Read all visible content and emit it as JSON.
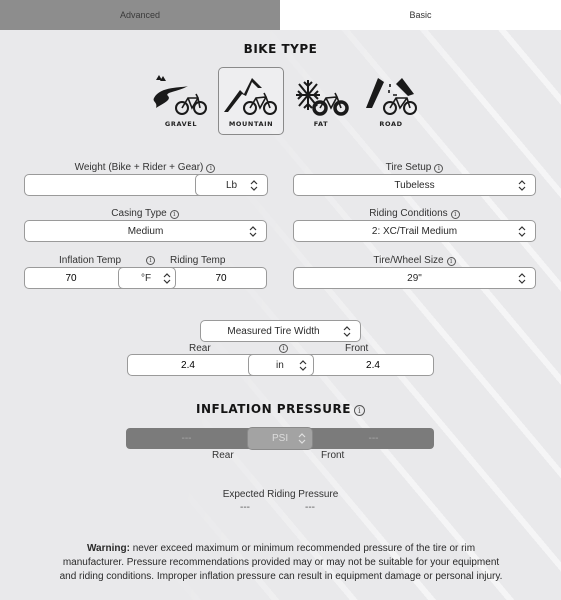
{
  "tabs": [
    {
      "label": "Advanced",
      "active": false
    },
    {
      "label": "Basic",
      "active": true
    }
  ],
  "bike_type": {
    "title": "BIKE TYPE",
    "options": [
      {
        "label": "GRAVEL",
        "icon": "gravel-bike-icon",
        "selected": false
      },
      {
        "label": "MOUNTAIN",
        "icon": "mountain-bike-icon",
        "selected": true
      },
      {
        "label": "FAT",
        "icon": "fat-bike-icon",
        "selected": false
      },
      {
        "label": "ROAD",
        "icon": "road-bike-icon",
        "selected": false
      }
    ]
  },
  "form": {
    "weight": {
      "label": "Weight (Bike + Rider + Gear)",
      "value": "",
      "unit": "Lb"
    },
    "tire_setup": {
      "label": "Tire Setup",
      "value": "Tubeless"
    },
    "casing_type": {
      "label": "Casing Type",
      "value": "Medium"
    },
    "riding_conditions": {
      "label": "Riding Conditions",
      "value": "2: XC/Trail Medium"
    },
    "inflation_temp": {
      "label": "Inflation Temp",
      "value": "70"
    },
    "temp_unit": "°F",
    "riding_temp": {
      "label": "Riding Temp",
      "value": "70"
    },
    "wheel_size": {
      "label": "Tire/Wheel Size",
      "value": "29\""
    },
    "width_mode": "Measured Tire Width",
    "rear_label": "Rear",
    "front_label": "Front",
    "rear_width": "2.4",
    "front_width": "2.4",
    "width_unit": "in"
  },
  "inflation": {
    "title": "INFLATION PRESSURE",
    "rear_value": "---",
    "front_value": "---",
    "unit": "PSI",
    "rear_label": "Rear",
    "front_label": "Front",
    "expected_label": "Expected Riding Pressure",
    "expected_rear": "---",
    "expected_front": "---"
  },
  "warning": {
    "bold": "Warning:",
    "text": " never exceed maximum or minimum recommended pressure of the tire or rim manufacturer. Pressure recommendations provided may or may not be suitable for your equipment and riding conditions. Improper inflation pressure can result in equipment damage or personal injury."
  },
  "info_glyph": "i"
}
